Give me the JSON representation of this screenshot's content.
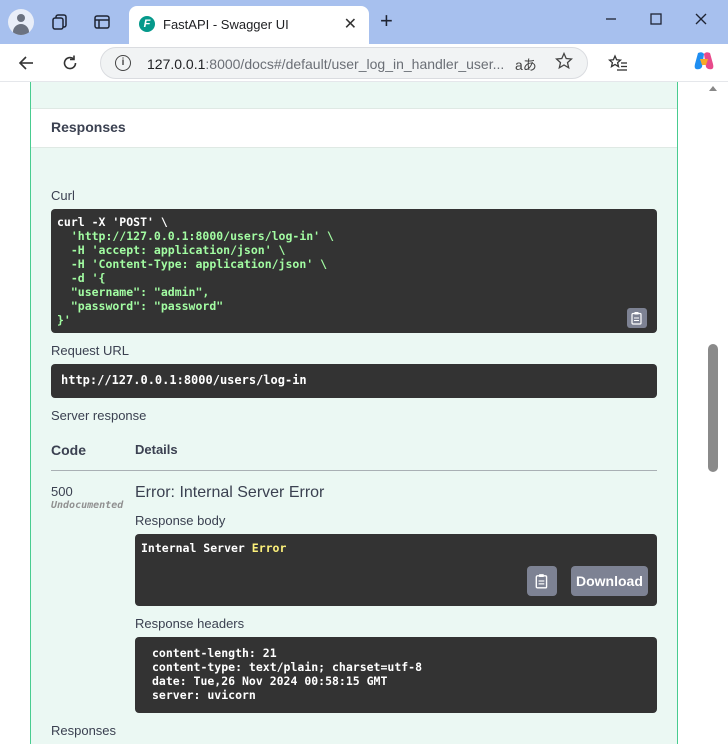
{
  "browser": {
    "tab_title": "FastAPI - Swagger UI",
    "tab_favicon_glyph": "F",
    "close_glyph": "✕",
    "new_tab_glyph": "+",
    "url_host": "127.0.0.1",
    "url_rest": ":8000/docs#/default/user_log_in_handler_user...",
    "read_aloud_glyph": "aあ",
    "info_glyph": "i",
    "icons": [
      "profile-icon",
      "workspaces-icon",
      "tab-actions-icon",
      "back-icon",
      "refresh-icon",
      "info-icon",
      "read-aloud-icon",
      "favorite-star-icon",
      "favorites-icon",
      "copilot-icon",
      "minimize-icon",
      "maximize-icon",
      "close-icon"
    ]
  },
  "responses_header": "Responses",
  "curl": {
    "label": "Curl",
    "lines": [
      "curl -X 'POST' \\",
      "  'http://127.0.0.1:8000/users/log-in' \\",
      "  -H 'accept: application/json' \\",
      "  -H 'Content-Type: application/json' \\",
      "  -d '{",
      "  \"username\": \"admin\",",
      "  \"password\": \"password\"",
      "}'"
    ]
  },
  "request_url": {
    "label": "Request URL",
    "value": "http://127.0.0.1:8000/users/log-in"
  },
  "server_response": {
    "label": "Server response",
    "col_code": "Code",
    "col_details": "Details",
    "code": "500",
    "undocumented": "Undocumented",
    "error_title": "Error: Internal Server Error",
    "body_label": "Response body",
    "body_text_plain": "Internal Server ",
    "body_text_highlight": "Error",
    "download_label": "Download",
    "headers_label": "Response headers",
    "headers": [
      "content-length: 21",
      "content-type: text/plain; charset=utf-8",
      "date: Tue,26 Nov 2024 00:58:15 GMT",
      "server: uvicorn"
    ]
  },
  "bottom_label": "Responses",
  "colors": {
    "tab_strip": "#a7c0ee",
    "op_background": "#ebf8f3",
    "op_border": "#49cc90",
    "code_background": "#333333",
    "button_gray": "#7d8293"
  }
}
